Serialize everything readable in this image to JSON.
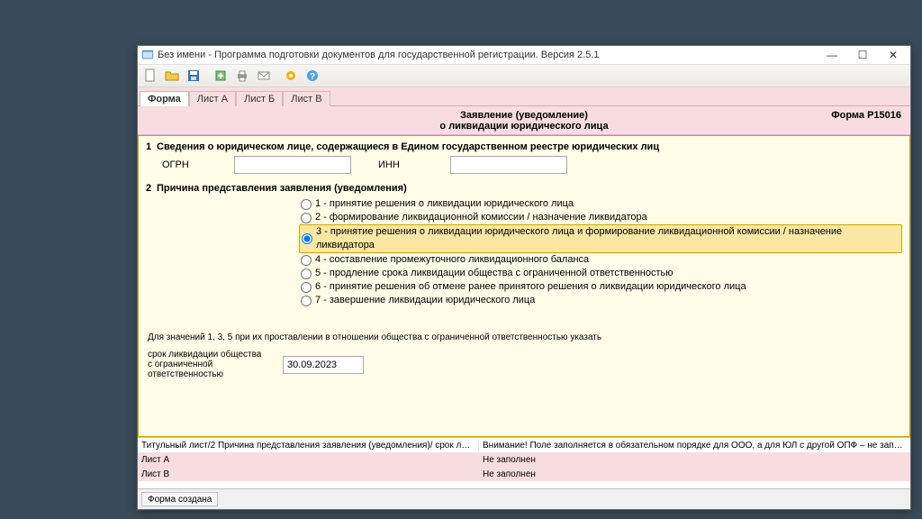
{
  "window": {
    "title": "Без имени - Программа подготовки документов для государственной регистрации. Версия 2.5.1"
  },
  "tabs": {
    "t0": "Форма",
    "t1": "Лист А",
    "t2": "Лист Б",
    "t3": "Лист В"
  },
  "header": {
    "line1": "Заявление (уведомление)",
    "line2": "о ликвидации юридического лица",
    "form_code": "Форма Р15016"
  },
  "section1": {
    "title": "Сведения о юридическом лице, содержащиеся в Едином государственном реестре юридических лиц",
    "ogrn_label": "ОГРН",
    "ogrn_value": "",
    "inn_label": "ИНН",
    "inn_value": ""
  },
  "section2": {
    "title": "Причина представления заявления (уведомления)",
    "options": {
      "o1": "1 - принятие решения о ликвидации юридического лица",
      "o2": "2 - формирование ликвидационной комиссии / назначение ликвидатора",
      "o3": "3 - принятие решения о ликвидации юридического лица и формирование ликвидационной комиссии / назначение ликвидатора",
      "o4": "4 - составление промежуточного ликвидационного баланса",
      "o5": "5 - продление срока ликвидации общества с ограниченной ответственностью",
      "o6": "6 - принятие решения об отмене ранее принятого решения о ликвидации юридического лица",
      "o7": "7 - завершение ликвидации юридического лица"
    },
    "selected": "o3",
    "note": "Для значений 1, 3, 5 при их проставлении в отношении общества с ограниченной ответственностью указать",
    "date_label": "срок ликвидации общества с ограниченной ответственностью",
    "date_value": "30.09.2023"
  },
  "grid": {
    "r1c1": "Титульный лист/2 Причина представления заявления (уведомления)/ срок ликвидации  общества с ог...",
    "r1c2": "Внимание! Поле заполняется в обязательном порядке для ООО, а для ЮЛ с другой ОПФ – не заполн...",
    "r2c1": "Лист А",
    "r2c2": "Не заполнен",
    "r3c1": "Лист В",
    "r3c2": "Не заполнен"
  },
  "status": "Форма создана"
}
